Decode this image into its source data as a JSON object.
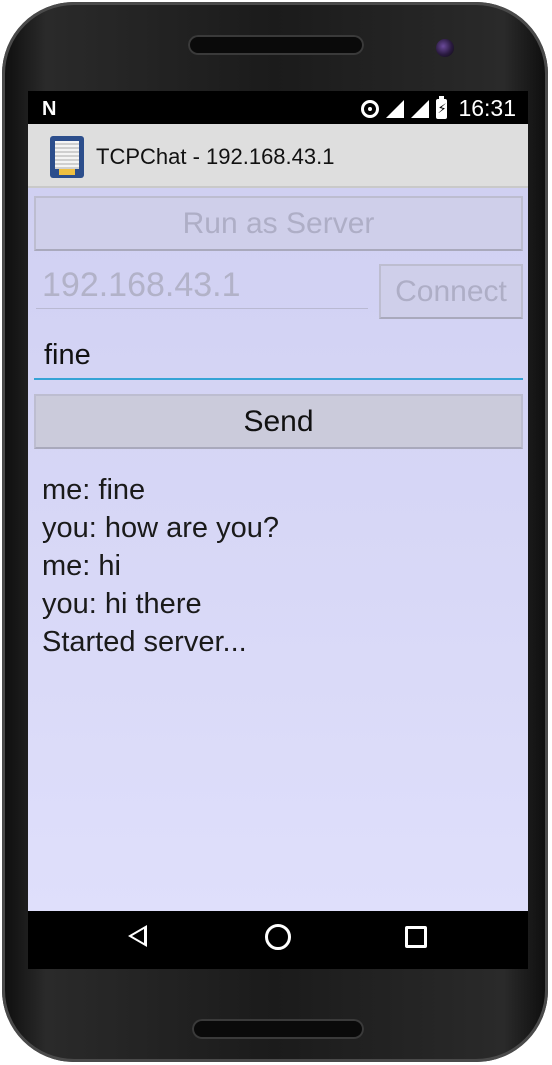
{
  "statusbar": {
    "notification_icon": "N",
    "time": "16:31",
    "battery_glyph": "⚡",
    "icons": [
      "notification-icon",
      "hotspot-icon",
      "signal-icon",
      "signal-icon",
      "battery-icon"
    ]
  },
  "titlebar": {
    "title": "TCPChat - 192.168.43.1",
    "icon": "app-icon"
  },
  "controls": {
    "run_server_label": "Run as Server",
    "ip_value": "192.168.43.1",
    "connect_label": "Connect",
    "message_value": "fine",
    "send_label": "Send"
  },
  "chat": {
    "lines": [
      "me: fine",
      "you: how are you?",
      "me: hi",
      "you: hi there",
      "Started server..."
    ]
  },
  "navbar": {
    "icons": [
      "back-icon",
      "home-icon",
      "recents-icon"
    ]
  },
  "colors": {
    "content_bg": "#d6d6f6",
    "input_underline_active": "#35a3d5",
    "button_bg": "#cbcbdb",
    "disabled_text": "#aeaec6",
    "titlebar_bg": "#dedede"
  }
}
